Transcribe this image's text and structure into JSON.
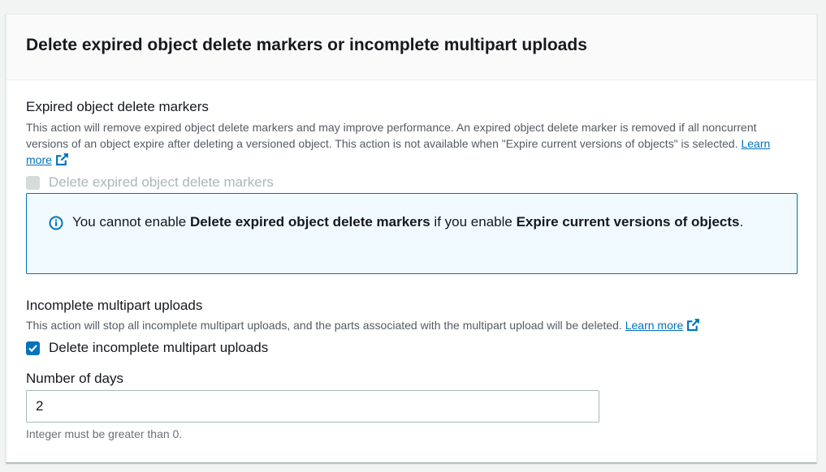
{
  "header": {
    "title": "Delete expired object delete markers or incomplete multipart uploads"
  },
  "expired_markers": {
    "label": "Expired object delete markers",
    "description": "This action will remove expired object delete markers and may improve performance. An expired object delete marker is removed if all noncurrent versions of an object expire after deleting a versioned object. This action is not available when \"Expire current versions of objects\" is selected.",
    "learn_more": "Learn more",
    "checkbox_label": "Delete expired object delete markers",
    "checkbox_checked": false,
    "checkbox_disabled": true
  },
  "info_alert": {
    "part1": "You cannot enable ",
    "bold1": "Delete expired object delete markers",
    "part2": " if you enable ",
    "bold2": "Expire current versions of objects",
    "part3": "."
  },
  "incomplete_uploads": {
    "label": "Incomplete multipart uploads",
    "description": "This action will stop all incomplete multipart uploads, and the parts associated with the multipart upload will be deleted.",
    "learn_more": "Learn more",
    "checkbox_label": "Delete incomplete multipart uploads",
    "checkbox_checked": true
  },
  "days_field": {
    "label": "Number of days",
    "value": "2",
    "hint": "Integer must be greater than 0."
  },
  "colors": {
    "link": "#0073bb",
    "info_bg": "#f1faff",
    "checkbox_checked": "#0073bb",
    "checkbox_disabled": "#d5dbdb"
  },
  "icons": {
    "external_link": "external-link-icon",
    "info": "info-icon",
    "checkmark": "checkmark-icon"
  }
}
